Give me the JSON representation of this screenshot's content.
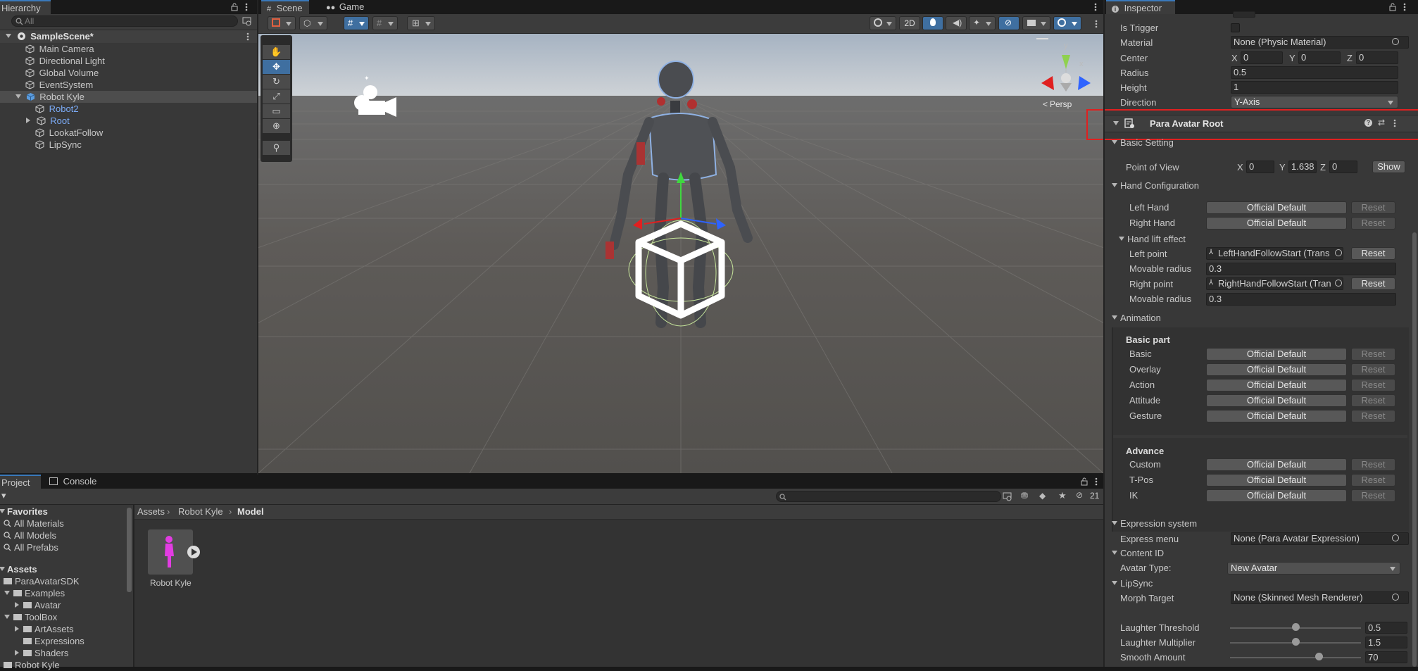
{
  "hierarchy": {
    "tab_label": "Hierarchy",
    "search_placeholder": "All",
    "scene_name": "SampleScene*",
    "items": [
      {
        "label": "Main Camera"
      },
      {
        "label": "Directional Light"
      },
      {
        "label": "Global Volume"
      },
      {
        "label": "EventSystem"
      },
      {
        "label": "Robot Kyle"
      },
      {
        "label": "Robot2"
      },
      {
        "label": "Root"
      },
      {
        "label": "LookatFollow"
      },
      {
        "label": "LipSync"
      }
    ]
  },
  "scene_view": {
    "tabs": [
      "Scene",
      "Game"
    ],
    "toolbar": {
      "mode_2d": "2D"
    },
    "persp_label": "Persp",
    "gizmo_axes": {
      "x": "x",
      "y": "y"
    }
  },
  "project": {
    "tabs": [
      "Project",
      "Console"
    ],
    "hidden_count": "21",
    "favorites_label": "Favorites",
    "favorites": [
      "All Materials",
      "All Models",
      "All Prefabs"
    ],
    "assets_label": "Assets",
    "tree": [
      {
        "label": "ParaAvatarSDK"
      },
      {
        "label": "Examples"
      },
      {
        "label": "Avatar"
      },
      {
        "label": "ToolBox"
      },
      {
        "label": "ArtAssets"
      },
      {
        "label": "Expressions"
      },
      {
        "label": "Shaders"
      },
      {
        "label": "Robot Kyle"
      }
    ],
    "breadcrumb": [
      "Assets",
      "Robot Kyle",
      "Model"
    ],
    "asset_name": "Robot Kyle"
  },
  "inspector": {
    "tab_label": "Inspector",
    "collider": {
      "is_trigger_label": "Is Trigger",
      "material_label": "Material",
      "material_value": "None (Physic Material)",
      "center_label": "Center",
      "center": {
        "x": "0",
        "y": "0",
        "z": "0"
      },
      "radius_label": "Radius",
      "radius_value": "0.5",
      "height_label": "Height",
      "height_value": "1",
      "direction_label": "Direction",
      "direction_value": "Y-Axis"
    },
    "component_title": "Para Avatar Root",
    "basic_setting": {
      "header": "Basic Setting",
      "pov_label": "Point of View",
      "pov": {
        "x": "0",
        "y": "1.638",
        "z": "0"
      },
      "show_button": "Show"
    },
    "hand_config": {
      "header": "Hand Configuration",
      "left_hand_label": "Left Hand",
      "right_hand_label": "Right Hand",
      "default_value": "Official Default",
      "reset_label": "Reset",
      "lift_header": "Hand lift effect",
      "left_point_label": "Left point",
      "left_point_value": "LeftHandFollowStart (Trans",
      "movable_radius_label": "Movable radius",
      "left_radius_value": "0.3",
      "right_point_label": "Right point",
      "right_point_value": "RightHandFollowStart (Tran",
      "right_radius_value": "0.3"
    },
    "animation": {
      "header": "Animation",
      "basic_part_label": "Basic part",
      "basic_rows": [
        "Basic",
        "Overlay",
        "Action",
        "Attitude",
        "Gesture"
      ],
      "advance_label": "Advance",
      "advance_rows": [
        "Custom",
        "T-Pos",
        "IK"
      ],
      "default_value": "Official Default",
      "reset_label": "Reset"
    },
    "expression": {
      "header": "Expression system",
      "menu_label": "Express menu",
      "menu_value": "None (Para Avatar Expression)"
    },
    "content_id": {
      "header": "Content ID",
      "type_label": "Avatar Type:",
      "type_value": "New Avatar"
    },
    "lipsync": {
      "header": "LipSync",
      "morph_label": "Morph Target",
      "morph_value": "None (Skinned Mesh Renderer)",
      "sliders": [
        {
          "label": "Laughter Threshold",
          "value": "0.5",
          "fraction": 0.5
        },
        {
          "label": "Laughter Multiplier",
          "value": "1.5",
          "fraction": 0.5
        },
        {
          "label": "Smooth Amount",
          "value": "70",
          "fraction": 0.68
        }
      ]
    }
  },
  "colors": {
    "accent": "#3a79bb",
    "highlight": "#e02020",
    "link_blue": "#7cacf8"
  }
}
